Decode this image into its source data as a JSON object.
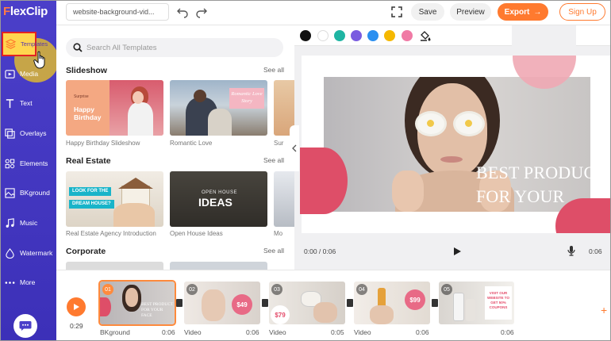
{
  "app": {
    "logo_f": "F",
    "logo_rest": "lexClip"
  },
  "topbar": {
    "file_name": "website-background-vid...",
    "save_label": "Save",
    "preview_label": "Preview",
    "export_label": "Export",
    "signup_label": "Sign Up"
  },
  "sidebar": {
    "items": [
      {
        "label": "Templates",
        "icon": "layers-icon"
      },
      {
        "label": "Media",
        "icon": "media-icon"
      },
      {
        "label": "Text",
        "icon": "text-icon"
      },
      {
        "label": "Overlays",
        "icon": "overlays-icon"
      },
      {
        "label": "Elements",
        "icon": "elements-icon"
      },
      {
        "label": "BKground",
        "icon": "background-icon"
      },
      {
        "label": "Music",
        "icon": "music-icon"
      },
      {
        "label": "Watermark",
        "icon": "watermark-icon"
      },
      {
        "label": "More",
        "icon": "more-icon"
      }
    ]
  },
  "templates": {
    "search_placeholder": "Search All Templates",
    "see_all": "See all",
    "sections": [
      {
        "title": "Slideshow",
        "items": [
          "Happy Birthday Slideshow",
          "Romantic Love",
          "Sur"
        ]
      },
      {
        "title": "Real Estate",
        "items": [
          "Real Estate Agency Introduction",
          "Open House Ideas",
          "Mo"
        ]
      },
      {
        "title": "Corporate",
        "items": []
      }
    ],
    "thumb_text": {
      "bday_small": "Surprise",
      "bday_big_1": "Happy",
      "bday_big_2": "Birthday",
      "romantic": "Romantic Love Story",
      "look_1": "LOOK FOR THE",
      "look_2": "DREAM HOUSE?",
      "open_small": "OPEN HOUSE",
      "open_big": "IDEAS"
    }
  },
  "swatches": [
    "#111111",
    "#ffffff",
    "#1fb5a3",
    "#7a5ce0",
    "#2a8ff0",
    "#f5b800",
    "#f07aa5"
  ],
  "preview": {
    "headline_1": "BEST PRODUCT",
    "headline_2": "FOR YOUR FACE",
    "time_current": "0:00 / 0:06",
    "time_total": "0:06"
  },
  "timeline": {
    "total": "0:29",
    "clips": [
      {
        "num": "01",
        "label": "BKground",
        "duration": "0:06",
        "badge_1": "BEST PRODUCT",
        "badge_2": "FOR YOUR FACE"
      },
      {
        "num": "02",
        "label": "Video",
        "duration": "0:06",
        "badge": "$49"
      },
      {
        "num": "03",
        "label": "Video",
        "duration": "0:05",
        "badge": "$79"
      },
      {
        "num": "04",
        "label": "Video",
        "duration": "0:06",
        "badge": "$99"
      },
      {
        "num": "05",
        "label": "",
        "duration": "0:06",
        "badge": "VISIT OUR WEBSITE TO GET 50% COUPONS"
      }
    ]
  }
}
